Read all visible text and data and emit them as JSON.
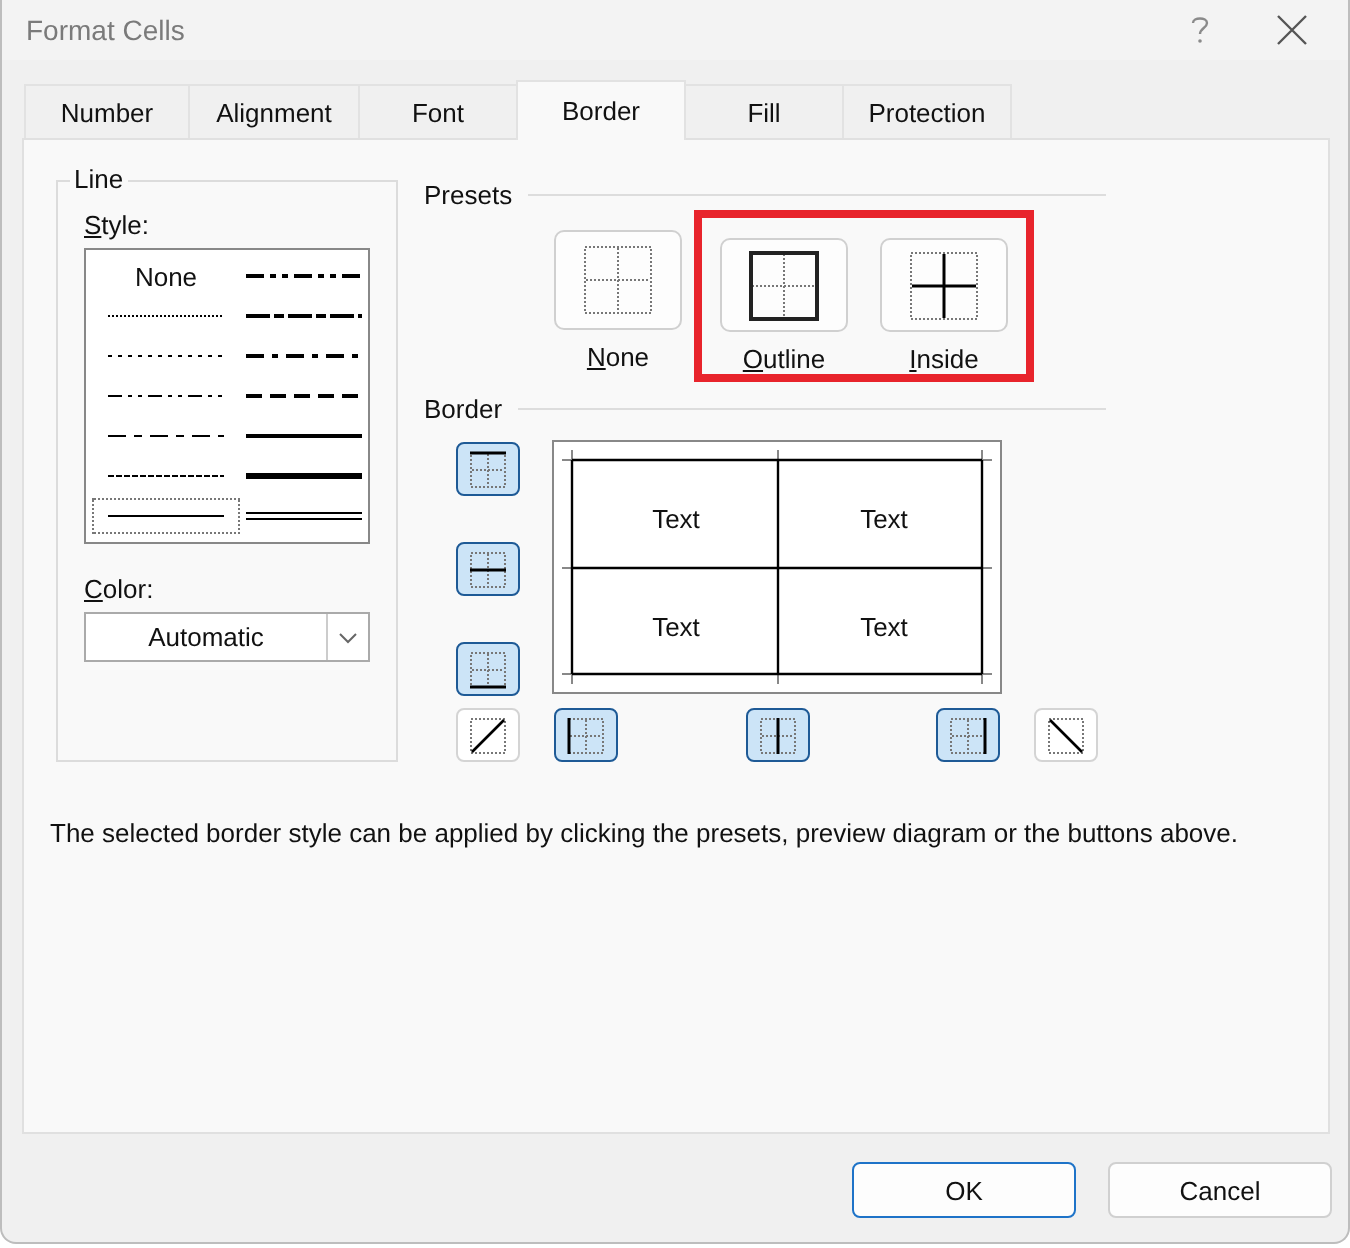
{
  "window": {
    "title": "Format Cells"
  },
  "tabs": [
    {
      "label": "Number",
      "selected": false
    },
    {
      "label": "Alignment",
      "selected": false
    },
    {
      "label": "Font",
      "selected": false
    },
    {
      "label": "Border",
      "selected": true
    },
    {
      "label": "Fill",
      "selected": false
    },
    {
      "label": "Protection",
      "selected": false
    }
  ],
  "line": {
    "heading": "Line",
    "style_label": "Style:",
    "color_label": "Color:",
    "color_value": "Automatic",
    "styles": [
      {
        "kind": "none",
        "label": "None",
        "selected": false
      },
      {
        "kind": "hair",
        "selected": false
      },
      {
        "kind": "dotted",
        "selected": false
      },
      {
        "kind": "dash-dot-dot",
        "selected": false
      },
      {
        "kind": "dash-dot",
        "selected": false
      },
      {
        "kind": "dashed",
        "selected": false
      },
      {
        "kind": "thin",
        "selected": true
      },
      {
        "kind": "medium-dash-dot-dot",
        "selected": false
      },
      {
        "kind": "slant-dash-dot",
        "selected": false
      },
      {
        "kind": "medium-dash-dot",
        "selected": false
      },
      {
        "kind": "medium-dashed",
        "selected": false
      },
      {
        "kind": "medium",
        "selected": false
      },
      {
        "kind": "thick",
        "selected": false
      },
      {
        "kind": "double",
        "selected": false
      }
    ]
  },
  "presets": {
    "heading": "Presets",
    "items": [
      {
        "kind": "none",
        "label": "None",
        "highlighted": false
      },
      {
        "kind": "outline",
        "label": "Outline",
        "highlighted": true
      },
      {
        "kind": "inside",
        "label": "Inside",
        "highlighted": true
      }
    ]
  },
  "border": {
    "heading": "Border",
    "buttons": [
      {
        "kind": "top",
        "on": true
      },
      {
        "kind": "middle-horizontal",
        "on": true
      },
      {
        "kind": "bottom",
        "on": true
      },
      {
        "kind": "diagonal-up",
        "on": false
      },
      {
        "kind": "left",
        "on": true
      },
      {
        "kind": "middle-vertical",
        "on": true
      },
      {
        "kind": "right",
        "on": true
      },
      {
        "kind": "diagonal-down",
        "on": false
      }
    ],
    "preview_cells": [
      "Text",
      "Text",
      "Text",
      "Text"
    ]
  },
  "description": "The selected border style can be applied by clicking the presets, preview diagram or the buttons above.",
  "buttons": [
    {
      "label": "OK",
      "default": true
    },
    {
      "label": "Cancel",
      "default": false
    }
  ]
}
